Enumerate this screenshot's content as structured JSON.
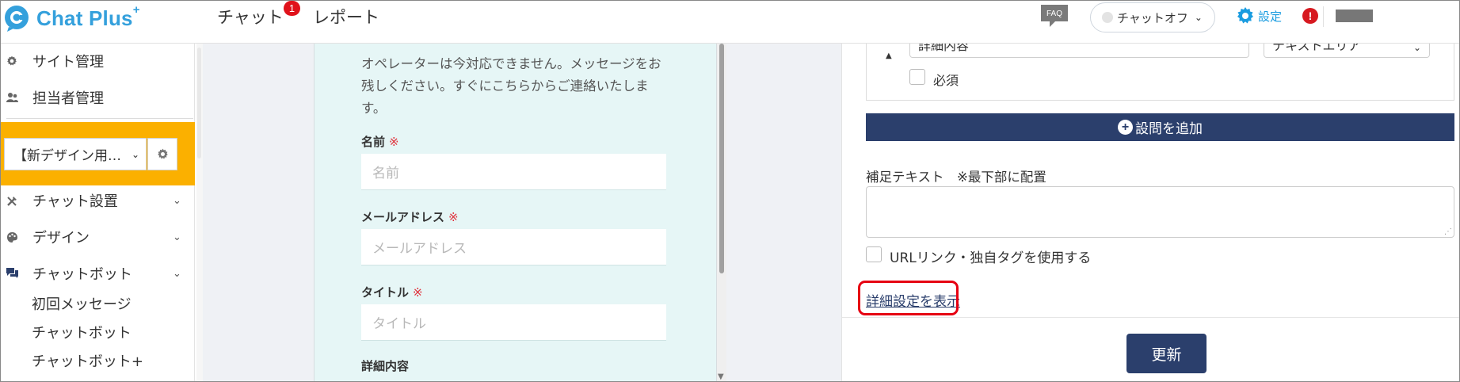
{
  "header": {
    "logo_text": "Chat Plus",
    "logo_sup": "+",
    "nav": [
      {
        "label": "チャット",
        "badge": "1"
      },
      {
        "label": "レポート"
      }
    ],
    "faq_label": "FAQ",
    "chat_status": "チャットオフ",
    "settings_label": "設定",
    "alert_glyph": "!"
  },
  "sidebar": {
    "top_items": [
      {
        "label": "サイト管理",
        "icon": "gear-icon"
      },
      {
        "label": "担当者管理",
        "icon": "users-icon"
      }
    ],
    "site_select": "【新デザイン用…",
    "menu_items": [
      {
        "label": "チャット設置",
        "icon": "tools-icon"
      },
      {
        "label": "デザイン",
        "icon": "palette-icon"
      },
      {
        "label": "チャットボット",
        "icon": "chat-icon"
      }
    ],
    "sub_items": [
      "初回メッセージ",
      "チャットボット",
      "チャットボット+"
    ]
  },
  "preview": {
    "message": "オペレーターは今対応できません。メッセージをお残しください。すぐにこちらからご連絡いたします。",
    "required_mark": "※",
    "fields": [
      {
        "label": "名前",
        "placeholder": "名前",
        "required": true
      },
      {
        "label": "メールアドレス",
        "placeholder": "メールアドレス",
        "required": true
      },
      {
        "label": "タイトル",
        "placeholder": "タイトル",
        "required": true
      },
      {
        "label": "詳細内容",
        "required": false
      }
    ]
  },
  "form_settings": {
    "question_value": "詳細内容",
    "question_type": "テキストエリア",
    "required_label": "必須",
    "add_question_label": "設問を追加",
    "supplement_label": "補足テキスト　※最下部に配置",
    "url_tag_label": "URLリンク・独自タグを使用する",
    "detail_link_label": "詳細設定を表示",
    "update_label": "更新"
  },
  "colors": {
    "brand_blue": "#34a0dc",
    "navy": "#2b3f6c",
    "highlight_orange": "#fbb000",
    "alert_red": "#e60012",
    "preview_bg": "#e6f6f6"
  }
}
